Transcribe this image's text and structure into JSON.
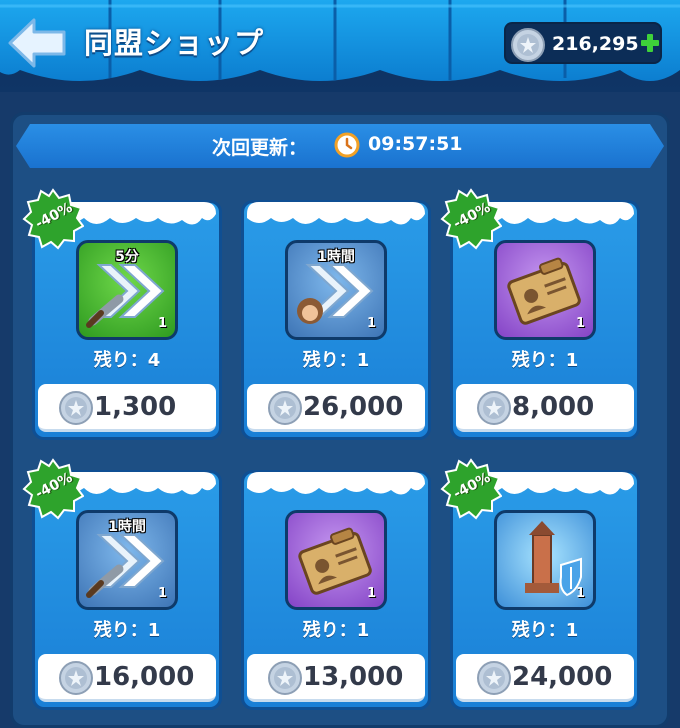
{
  "header": {
    "title": "同盟ショップ",
    "currency_amount": "216,295",
    "back_icon": "back-arrow-icon",
    "plus_icon": "plus-icon"
  },
  "timer": {
    "label": "次回更新：",
    "value": "09:57:51",
    "icon": "clock-icon"
  },
  "colors": {
    "discount_badge": "#2ea32c",
    "card": "#1f8bdd",
    "price_text": "#333a4a"
  },
  "cards": [
    {
      "badge": "-40%",
      "item_label": "5分",
      "item_qty": "1",
      "item_icon": "speedup-sword-icon",
      "remaining": "残り：4",
      "price": "1,300"
    },
    {
      "badge": "",
      "item_label": "1時間",
      "item_qty": "1",
      "item_icon": "speedup-hero-icon",
      "remaining": "残り：1",
      "price": "26,000"
    },
    {
      "badge": "-40%",
      "item_label": "",
      "item_qty": "1",
      "item_icon": "id-card-icon",
      "remaining": "残り：1",
      "price": "8,000"
    },
    {
      "badge": "-40%",
      "item_label": "1時間",
      "item_qty": "1",
      "item_icon": "speedup-sword-icon",
      "remaining": "残り：1",
      "price": "16,000"
    },
    {
      "badge": "",
      "item_label": "",
      "item_qty": "1",
      "item_icon": "id-card-icon",
      "remaining": "残り：1",
      "price": "13,000"
    },
    {
      "badge": "-40%",
      "item_label": "",
      "item_qty": "1",
      "item_icon": "tower-shield-icon",
      "remaining": "残り：1",
      "price": "24,000"
    }
  ]
}
